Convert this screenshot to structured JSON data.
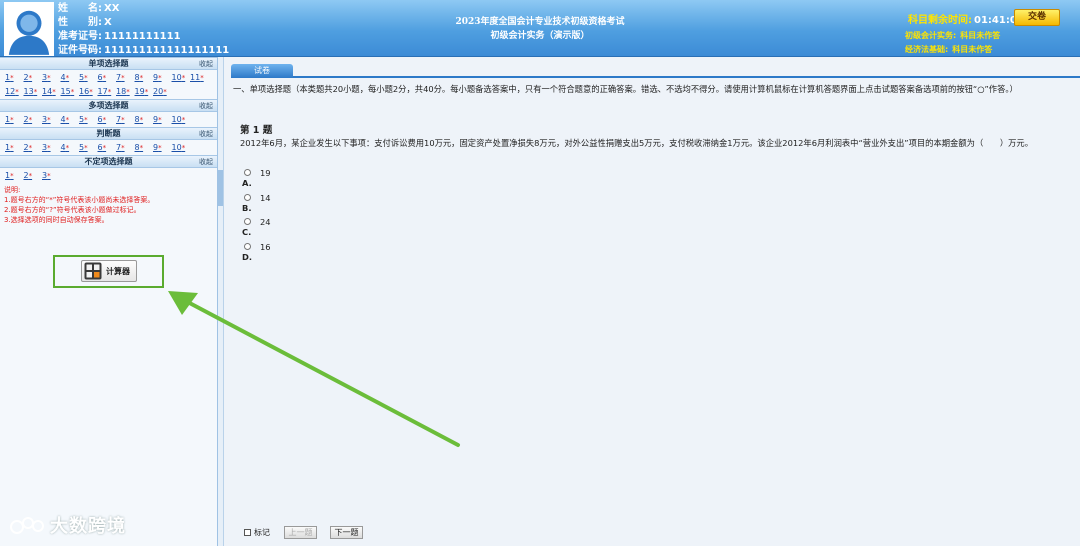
{
  "header": {
    "name_label": "姓　　名:",
    "name_value": "XX",
    "gender_label": "性　　别:",
    "gender_value": "X",
    "admission_label": "准考证号:",
    "admission_value": "11111111111",
    "id_label": "证件号码:",
    "id_value": "111111111111111111",
    "exam_title": "2023年度全国会计专业技术初级资格考试",
    "exam_subtitle": "初级会计实务（演示版）",
    "timer_label": "科目剩余时间:",
    "timer_value": "01:41:05",
    "submit_label": "交卷",
    "subject_status": [
      {
        "name": "初级会计实务",
        "status": "科目未作答"
      },
      {
        "name": "经济法基础",
        "status": "科目未作答"
      }
    ]
  },
  "sidebar": {
    "collapse_label": "收起",
    "sections": [
      {
        "title": "单项选择题",
        "numbers": [
          "1",
          "2",
          "3",
          "4",
          "5",
          "6",
          "7",
          "8",
          "9",
          "10",
          "11",
          "12",
          "13",
          "14",
          "15",
          "16",
          "17",
          "18",
          "19",
          "20"
        ]
      },
      {
        "title": "多项选择题",
        "numbers": [
          "1",
          "2",
          "3",
          "4",
          "5",
          "6",
          "7",
          "8",
          "9",
          "10"
        ]
      },
      {
        "title": "判断题",
        "numbers": [
          "1",
          "2",
          "3",
          "4",
          "5",
          "6",
          "7",
          "8",
          "9",
          "10"
        ]
      },
      {
        "title": "不定项选择题",
        "numbers": [
          "1",
          "2",
          "3"
        ]
      }
    ],
    "star": "*",
    "notes": [
      "说明:",
      "1.题号右方的“*”符号代表该小题尚未选择答案。",
      "2.题号右方的“?”符号代表该小题做过标记。",
      "3.选择选项的同时自动保存答案。"
    ],
    "calculator_label": "计算器"
  },
  "main": {
    "tab_label": "试卷",
    "instruction": "一、单项选择题（本类题共20小题，每小题2分，共40分。每小题备选答案中，只有一个符合题意的正确答案。错选、不选均不得分。请使用计算机鼠标在计算机答题界面上点击试题答案备选项前的按钮“○”作答。）",
    "question_title": "第 1 题",
    "question_text": "2012年6月，某企业发生以下事项：支付诉讼费用10万元，固定资产处置净损失8万元，对外公益性捐赠支出5万元，支付税收滞纳金1万元。该企业2012年6月利润表中“营业外支出”项目的本期金额为（　　）万元。",
    "options": [
      {
        "letter": "A.",
        "value": "19"
      },
      {
        "letter": "B.",
        "value": "14"
      },
      {
        "letter": "C.",
        "value": "24"
      },
      {
        "letter": "D.",
        "value": "16"
      }
    ],
    "mark_label": "标记",
    "prev_label": "上一题",
    "next_label": "下一题"
  },
  "watermark": {
    "text": "大数跨境"
  },
  "colors": {
    "header": "#4f9fe0",
    "accent": "#2d79c8",
    "highlight": "#5aab2f",
    "warning": "#e02020"
  }
}
